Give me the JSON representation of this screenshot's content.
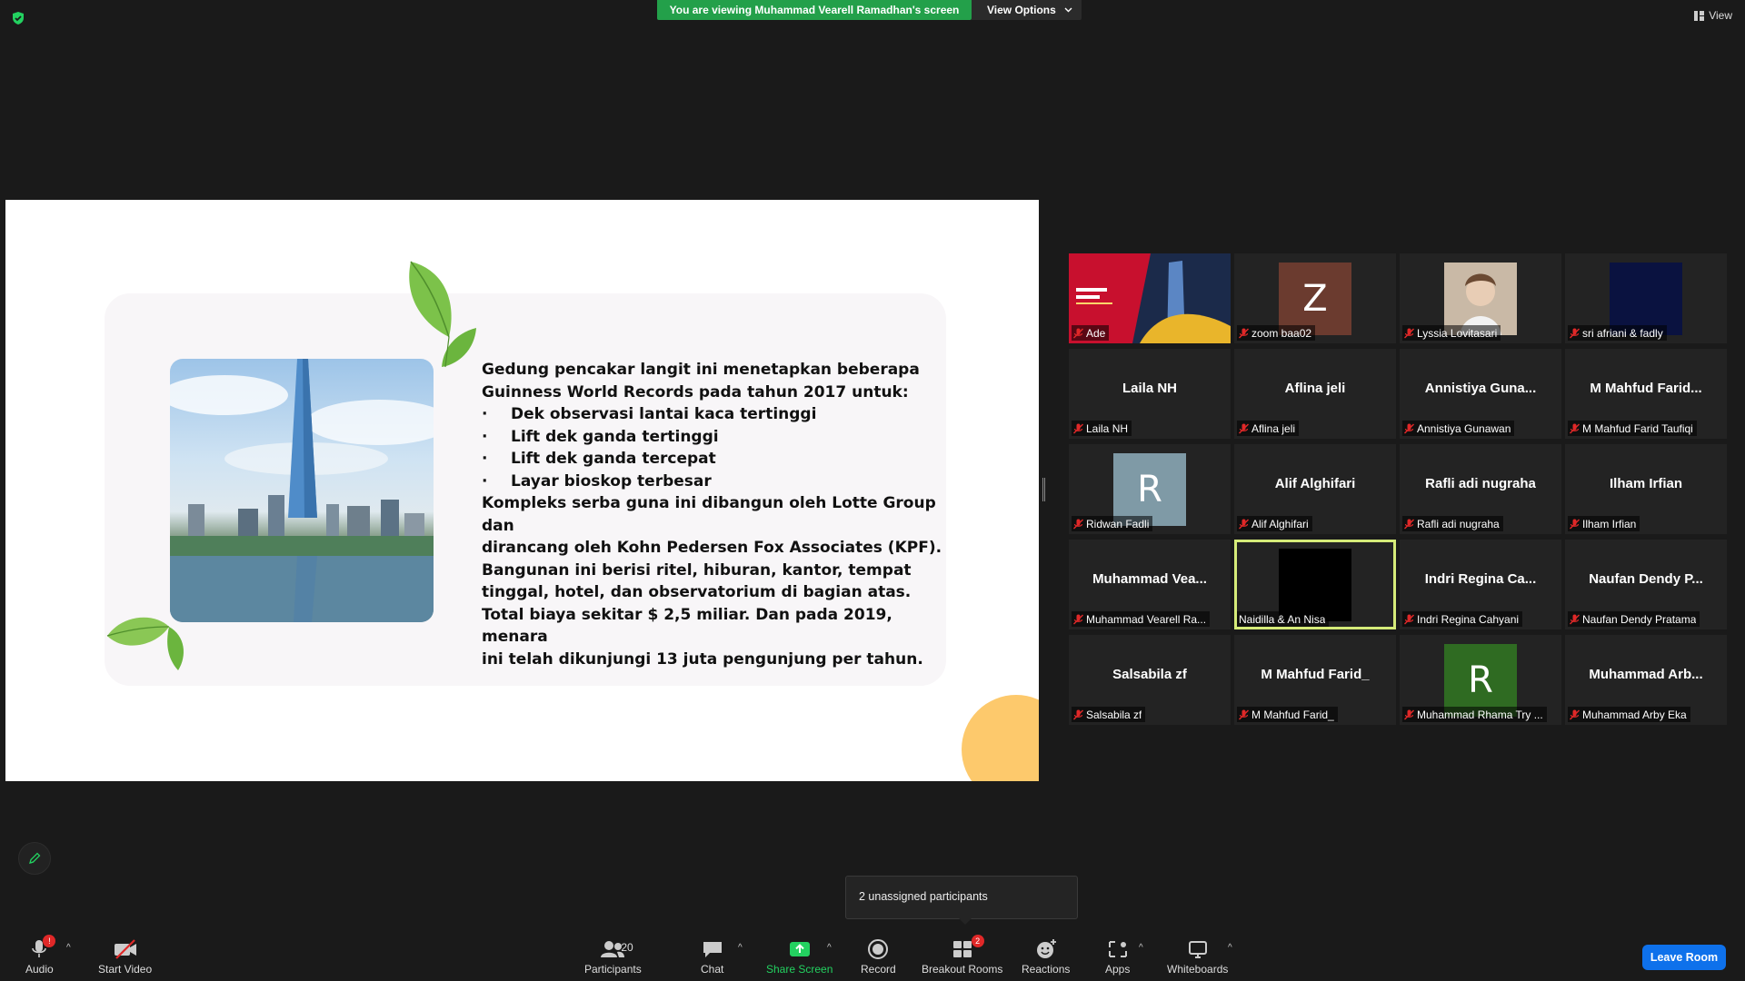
{
  "banner": {
    "viewing": "You are viewing Muhammad Vearell Ramadhan's screen",
    "view_options": "View Options",
    "view": "View"
  },
  "slide": {
    "line1": "Gedung pencakar langit ini menetapkan beberapa",
    "line2": "Guinness World Records pada tahun 2017 untuk:",
    "bullets": [
      "Dek observasi lantai kaca tertinggi",
      "Lift dek ganda tertinggi",
      "Lift dek ganda tercepat",
      "Layar bioskop terbesar"
    ],
    "bullet_char": "·",
    "para1_l1": "Kompleks serba guna ini dibangun oleh Lotte Group dan",
    "para1_l2": "dirancang oleh Kohn Pedersen Fox Associates (KPF).",
    "para2_l1": "Bangunan ini berisi ritel, hiburan, kantor, tempat",
    "para2_l2": "tinggal, hotel, dan observatorium di bagian atas.",
    "para3_l1": "Total biaya sekitar $ 2,5 miliar. Dan pada 2019, menara",
    "para3_l2": "ini telah dikunjungi 13 juta pengunjung per tahun."
  },
  "participants": [
    {
      "name": "Ade"
    },
    {
      "name": "zoom baa02",
      "avatar": "Z"
    },
    {
      "name": "Lyssia Lovitasari"
    },
    {
      "name": "sri afriani & fadly"
    },
    {
      "center": "Laila NH",
      "name": "Laila NH"
    },
    {
      "center": "Aflina jeli",
      "name": "Aflina jeli"
    },
    {
      "center": "Annistiya Guna...",
      "name": "Annistiya Gunawan"
    },
    {
      "center": "M Mahfud Farid...",
      "name": "M Mahfud Farid Taufiqi"
    },
    {
      "name": "Ridwan Fadli",
      "avatar": "R"
    },
    {
      "center": "Alif Alghifari",
      "name": "Alif Alghifari"
    },
    {
      "center": "Rafli adi nugraha",
      "name": "Rafli adi nugraha"
    },
    {
      "center": "Ilham Irfian",
      "name": "Ilham Irfian"
    },
    {
      "center": "Muhammad Vea...",
      "name": "Muhammad Vearell Ra..."
    },
    {
      "name": "Naidilla & An Nisa"
    },
    {
      "center": "Indri Regina Ca...",
      "name": "Indri Regina Cahyani"
    },
    {
      "center": "Naufan Dendy P...",
      "name": "Naufan Dendy Pratama"
    },
    {
      "center": "Salsabila zf",
      "name": "Salsabila zf"
    },
    {
      "center": "M Mahfud Farid_",
      "name": "M Mahfud Farid_"
    },
    {
      "name": "Muhammad Rhama Try ...",
      "avatar": "R"
    },
    {
      "center": "Muhammad Arb...",
      "name": "Muhammad Arby Eka"
    }
  ],
  "tooltip": "2 unassigned participants",
  "toolbar": {
    "audio": "Audio",
    "audio_badge": "!",
    "start_video": "Start Video",
    "participants": "Participants",
    "participants_count": "20",
    "chat": "Chat",
    "share_screen": "Share Screen",
    "record": "Record",
    "breakout_rooms": "Breakout Rooms",
    "breakout_badge": "2",
    "reactions": "Reactions",
    "apps": "Apps",
    "whiteboards": "Whiteboards",
    "leave_room": "Leave Room"
  },
  "colors": {
    "share_green": "#23a04a",
    "leave_blue": "#0e71eb",
    "active_speaker": "#d5eb79",
    "muted_red": "#e02828"
  }
}
